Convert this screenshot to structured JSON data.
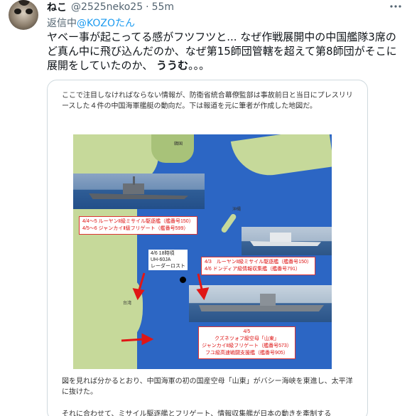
{
  "tweet": {
    "display_name": "ねこ",
    "handle": "@2525neko25",
    "separator": "·",
    "time": "55m",
    "more_icon": "more-horizontal-icon",
    "reply_prefix": "返信中",
    "reply_to": "@KOZOたん",
    "text_normal": "ヤベー事が起こってる感がフツフツと... なぜ作戦展開中の中国艦隊3席のど真ん中に飛び込んだのか、なぜ第15師団管轄を超えて第8師団がそこに展開をしていたのか、",
    "text_bold": "ううむ",
    "text_end": "。。。"
  },
  "article": {
    "para1": "ここで注目しなければならない情報が、防衛省統合幕僚監部は事故前日と当日にプレスリリースした４件の中国海軍艦艇の動向だ。下は報道を元に筆者が作成した地図だ。",
    "para2": "図を見れば分かるとおり、中国海軍の初の国産空母「山東」がバシー海峡を東進し、太平洋に抜けた。",
    "para3": "それに合わせて、ミサイル駆逐艦とフリゲート、情報収集艦が日本の動きを牽制する"
  },
  "map": {
    "label1_line1": "4/4～5 ルーヤンⅡ級ミサイル駆逐艦（艦番号150）",
    "label1_line2": "4/5～6 ジャンカイⅡ級フリゲート（艦番号599）",
    "label2_line1": "4/3　ルーヤンⅡ級ミサイル駆逐艦（艦番号150）",
    "label2_line2": "4/6 ドンディア級情報収集艦（艦番号791）",
    "label3_line1": "4/5",
    "label3_line2": "クズネツォフ級空母「山東」",
    "label3_line3": "ジャンカイⅡ級フリゲート（艦番号573）",
    "label3_line4": "フユ級高速戦闘支援艦（艦番号905）",
    "lost_line1": "4/6 18時頃",
    "lost_line2": "UH-60JA",
    "lost_line3": "レーダーロスト",
    "place_taiwan": "台湾",
    "place_korea": "韓国",
    "place_okinawa": "沖縄"
  },
  "colors": {
    "link": "#1d9bf0",
    "secondary_text": "#536471",
    "sea": "#2c66c4",
    "land": "#c6d99a",
    "annotation_red": "#e01616"
  }
}
